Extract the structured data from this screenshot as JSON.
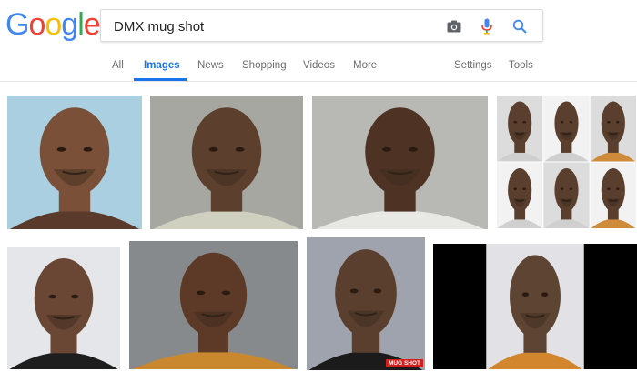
{
  "logo": {
    "letters": [
      "G",
      "o",
      "o",
      "g",
      "l",
      "e"
    ],
    "colors": [
      "#4285f4",
      "#ea4335",
      "#fbbc05",
      "#4285f4",
      "#34a853",
      "#ea4335"
    ]
  },
  "search": {
    "query": "DMX mug shot"
  },
  "search_icons": [
    "camera-icon",
    "microphone-icon",
    "search-icon"
  ],
  "nav": {
    "tabs": [
      "All",
      "Images",
      "News",
      "Shopping",
      "Videos",
      "More"
    ],
    "active": "Images",
    "settings": "Settings",
    "tools": "Tools"
  },
  "images": [
    {
      "name": "mugshot-1",
      "bg": "#a9cfe0",
      "skin": "#7a5038",
      "shirt": "#5a3a2a"
    },
    {
      "name": "mugshot-2",
      "bg": "#a7a7a2",
      "skin": "#5d3f2d",
      "shirt": "#cfd0c0"
    },
    {
      "name": "mugshot-3",
      "bg": "#b8b8b4",
      "skin": "#4e3324",
      "shirt": "#e8e8e4"
    },
    {
      "name": "mugshot-collage",
      "bg": "#e8e8e8",
      "skin": "#5a3e2e",
      "shirt": "#cfcfcf"
    },
    {
      "name": "mugshot-5",
      "bg": "#e4e6ea",
      "skin": "#6a4634",
      "shirt": "#1e1e1e"
    },
    {
      "name": "mugshot-6",
      "bg": "#878a8c",
      "skin": "#5d3a27",
      "shirt": "#c9882e"
    },
    {
      "name": "mugshot-7",
      "bg": "#9ea3ad",
      "skin": "#5a3f2f",
      "shirt": "#1b1b1b",
      "badge": "MUG SHOT"
    },
    {
      "name": "mugshot-8",
      "bg": "#e2e2e6",
      "skin": "#5e4432",
      "shirt": "#d2872f"
    }
  ]
}
